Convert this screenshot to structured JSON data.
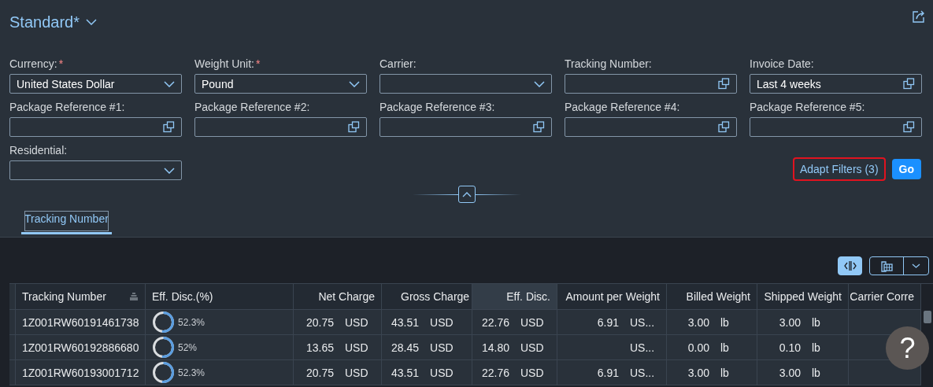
{
  "variant": {
    "title": "Standard*"
  },
  "filters": [
    {
      "label": "Currency:",
      "required_mark": "*",
      "kind": "select",
      "value": "United States Dollar"
    },
    {
      "label": "Weight Unit:",
      "required_mark": "*",
      "kind": "select",
      "value": "Pound"
    },
    {
      "label": "Carrier:",
      "kind": "select"
    },
    {
      "label": "Tracking Number:",
      "kind": "valuehelp"
    },
    {
      "label": "Invoice Date:",
      "kind": "valuehelp",
      "value": "Last 4 weeks"
    },
    {
      "label": "Package Reference #1:",
      "kind": "valuehelp"
    },
    {
      "label": "Package Reference #2:",
      "kind": "valuehelp"
    },
    {
      "label": "Package Reference #3:",
      "kind": "valuehelp"
    },
    {
      "label": "Package Reference #4:",
      "kind": "valuehelp"
    },
    {
      "label": "Package Reference #5:",
      "kind": "valuehelp"
    },
    {
      "label": "Residential:",
      "kind": "select"
    }
  ],
  "actions": {
    "adapt_filters": "Adapt Filters (3)",
    "go": "Go"
  },
  "tabs": [
    {
      "label": "Tracking Number",
      "selected": true
    }
  ],
  "table": {
    "columns": [
      {
        "label": "Tracking Number",
        "highlighted": false
      },
      {
        "label": "Eff. Disc.(%)",
        "highlighted": false
      },
      {
        "label": "Net Charge",
        "highlighted": false
      },
      {
        "label": "Gross Charge",
        "highlighted": false
      },
      {
        "label": "Eff. Disc.",
        "highlighted": true
      },
      {
        "label": "Amount per Weight",
        "highlighted": false
      },
      {
        "label": "Billed Weight",
        "highlighted": false
      },
      {
        "label": "Shipped Weight",
        "highlighted": false
      },
      {
        "label": "Carrier Corre",
        "highlighted": false
      }
    ],
    "rows": [
      {
        "tracking": "1Z001RW60191461738",
        "disc": {
          "text": "52.3%"
        },
        "net": {
          "amount": "20.75",
          "unit": "USD"
        },
        "gross": {
          "amount": "43.51",
          "unit": "USD"
        },
        "eff": {
          "amount": "22.76",
          "unit": "USD"
        },
        "per_weight": {
          "amount": "6.91",
          "unit": "US..."
        },
        "billed": {
          "amount": "3.00",
          "unit": "lb"
        },
        "shipped": {
          "amount": "3.00",
          "unit": "lb"
        }
      },
      {
        "tracking": "1Z001RW60192886680",
        "disc": {
          "text": "52%"
        },
        "net": {
          "amount": "13.65",
          "unit": "USD"
        },
        "gross": {
          "amount": "28.45",
          "unit": "USD"
        },
        "eff": {
          "amount": "14.80",
          "unit": "USD"
        },
        "per_weight": {
          "unit": "US..."
        },
        "billed": {
          "amount": "0.00",
          "unit": "lb"
        },
        "shipped": {
          "amount": "0.10",
          "unit": "lb"
        }
      },
      {
        "tracking": "1Z001RW60193001712",
        "disc": {
          "text": "52.3%"
        },
        "net": {
          "amount": "20.75",
          "unit": "USD"
        },
        "gross": {
          "amount": "43.51",
          "unit": "USD"
        },
        "eff": {
          "amount": "22.76",
          "unit": "USD"
        },
        "per_weight": {
          "amount": "6.91",
          "unit": "US..."
        },
        "billed": {
          "amount": "3.00",
          "unit": "lb"
        },
        "shipped": {
          "amount": "3.00",
          "unit": "lb"
        }
      }
    ]
  },
  "help": {
    "label": "?"
  }
}
